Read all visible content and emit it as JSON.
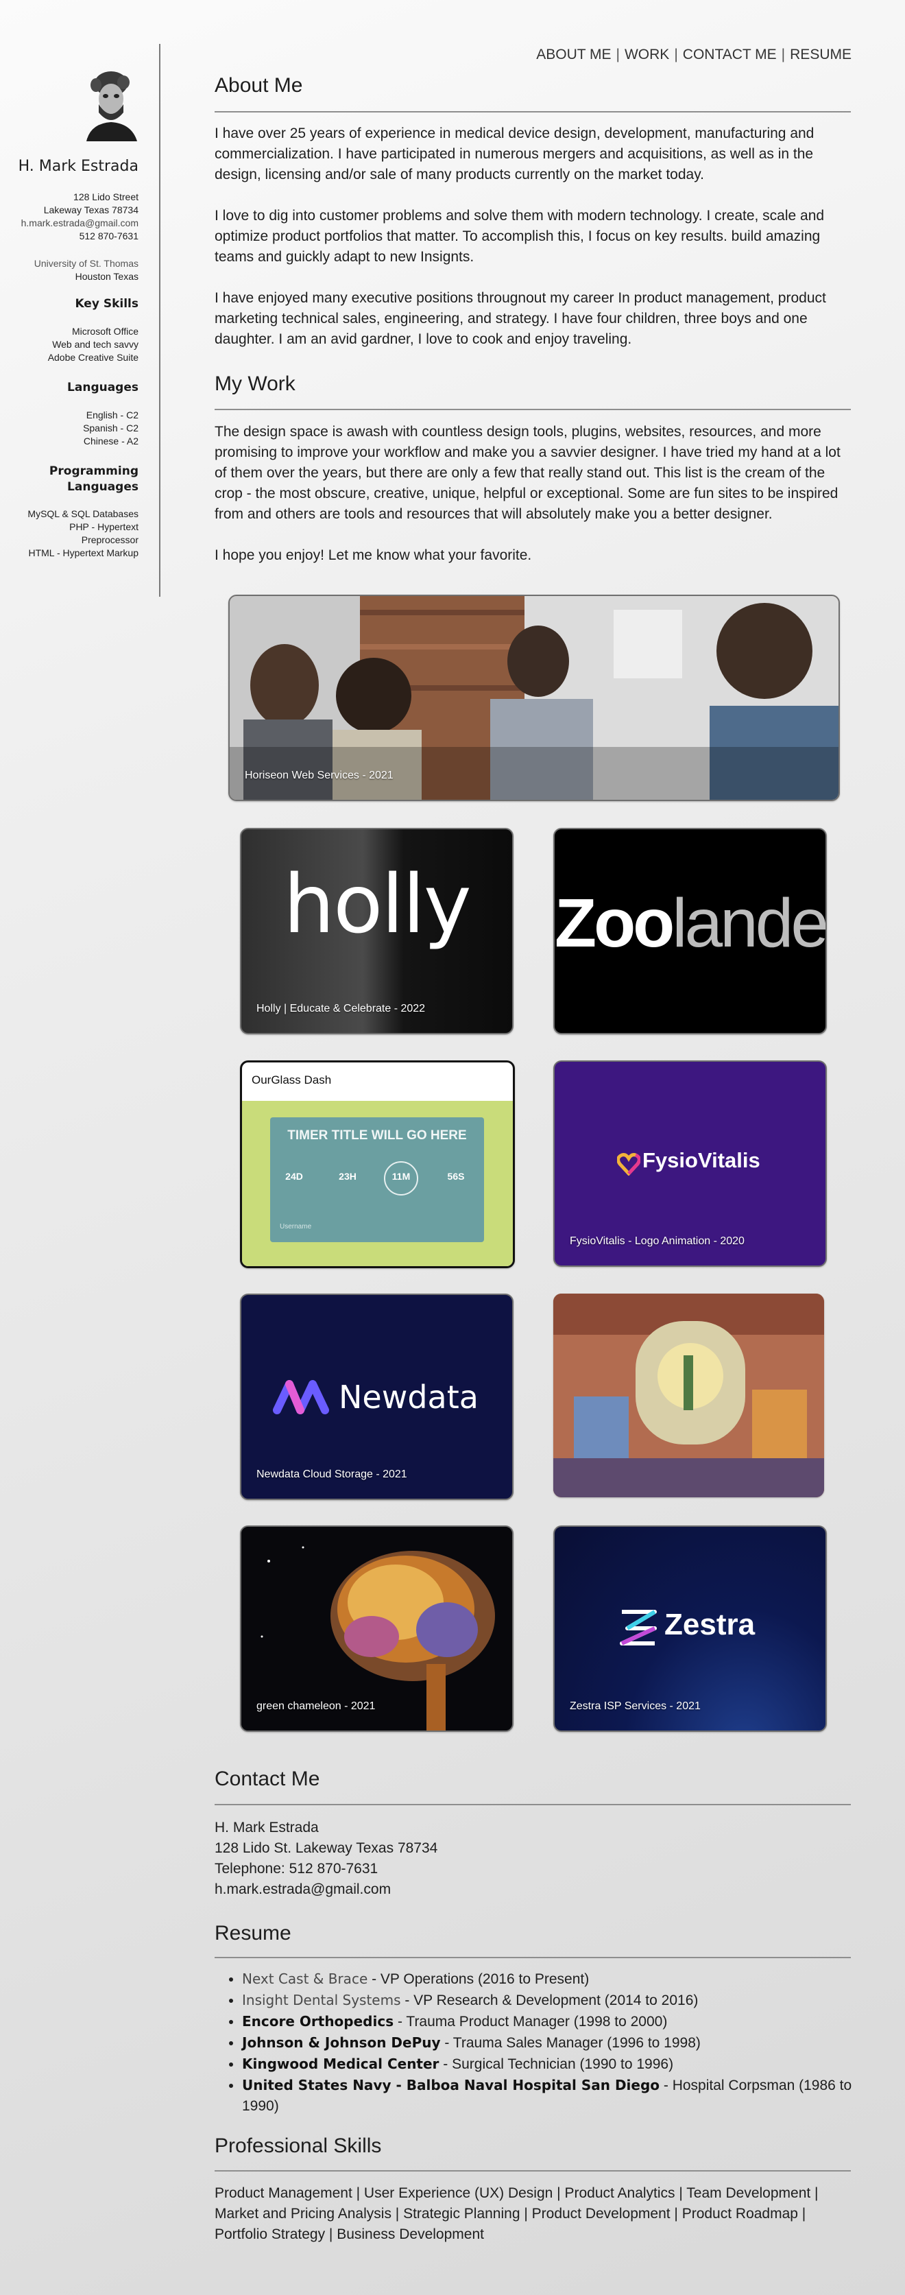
{
  "nav": {
    "about": "ABOUT ME",
    "work": "WORK",
    "contact": "CONTACT ME",
    "resume": "RESUME",
    "separator": "|"
  },
  "sidebar": {
    "name": "H. Mark Estrada",
    "address1": "128 Lido Street",
    "address2": "Lakeway Texas 78734",
    "email": "h.mark.estrada@gmail.com",
    "phone": "512 870-7631",
    "school": "University of St. Thomas",
    "school_city": "Houston Texas",
    "key_skills_heading": "Key Skills",
    "key_skills": [
      "Microsoft Office",
      "Web and tech savvy",
      "Adobe Creative Suite"
    ],
    "languages_heading": "Languages",
    "languages": [
      "English - C2",
      "Spanish - C2",
      "Chinese - A2"
    ],
    "programming_heading_1": "Programming",
    "programming_heading_2": "Languages",
    "programming": [
      "MySQL & SQL Databases",
      "PHP - Hypertext",
      "Preprocessor",
      "HTML - Hypertext Markup"
    ]
  },
  "about": {
    "title": "About Me",
    "p1": "I have over 25 years of experience in medical device design, development, manufacturing and commercialization. I have participated in numerous mergers and acquisitions, as well as in the design, licensing and/or sale of many products currently on the market today.",
    "p2": "I love to dig into customer problems and solve them with modern technology. I create, scale and optimize product portfolios that matter. To accomplish this, I focus on key results. build amazing teams and guickly adapt to new Insignts.",
    "p3": "I have enjoyed many executive positions througnout my career In product management, product marketing technical sales, engineering, and strategy. I have four children, three boys and one daughter. I am an avid gardner, I love to cook and enjoy traveling."
  },
  "work": {
    "title": "My Work",
    "p1": "The design space is awash with countless design tools, plugins, websites, resources, and more promising to improve your workflow and make you a savvier designer. I have tried my hand at a lot of them over the years, but there are only a few that really stand out. This list is the cream of the crop - the most obscure, creative, unique, helpful or exceptional. Some are fun sites to be inspired from and others are tools and resources that will absolutely make you a better designer.",
    "p2": "I hope you enjoy! Let me know what your favorite.",
    "cards": {
      "horiseon": "Horiseon Web Services - 2021",
      "holly_logo": "holly",
      "holly": "Holly | Educate & Celebrate - 2022",
      "zoo_logo_a": "Zoo",
      "zoo_logo_b": "lander",
      "ourglass_title": "OurGlass Dash",
      "ourglass_timer": "TIMER TITLE WILL GO HERE",
      "ourglass_units": [
        "24D",
        "23H",
        "11M",
        "56S"
      ],
      "ourglass_user": "Username",
      "fysio_logo": "FysioVitalis",
      "fysio": "FysioVitalis - Logo Animation - 2020",
      "newdata_logo": "Newdata",
      "newdata": "Newdata Cloud Storage - 2021",
      "chameleon": "green chameleon - 2021",
      "zestra_logo": "Zestra",
      "zestra": "Zestra ISP Services - 2021"
    }
  },
  "contact": {
    "title": "Contact Me",
    "name": "H. Mark Estrada",
    "address": "128 Lido St. Lakeway Texas 78734",
    "phone": "Telephone: 512 870-7631",
    "email": "h.mark.estrada@gmail.com"
  },
  "resume": {
    "title": "Resume",
    "items": [
      {
        "company": "Next Cast & Brace",
        "rest": " - VP Operations (2016 to Present)"
      },
      {
        "company": "Insight Dental Systems",
        "rest": " - VP Research & Development (2014 to 2016)"
      },
      {
        "company": "Encore Orthopedics",
        "rest": " - Trauma Product Manager (1998 to 2000)"
      },
      {
        "company": "Johnson & Johnson DePuy",
        "rest": " - Trauma Sales Manager (1996 to 1998)"
      },
      {
        "company": "Kingwood Medical Center",
        "rest": " - Surgical Technician (1990 to 1996)"
      },
      {
        "company": "United States Navy - Balboa Naval Hospital San Diego",
        "rest": " - Hospital Corpsman (1986 to 1990)"
      }
    ]
  },
  "skills": {
    "title": "Professional Skills",
    "text": "Product Management | User Experience (UX) Design | Product Analytics | Team Development | Market and Pricing Analysis | Strategic Planning | Product Development | Product Roadmap | Portfolio Strategy | Business Development"
  }
}
